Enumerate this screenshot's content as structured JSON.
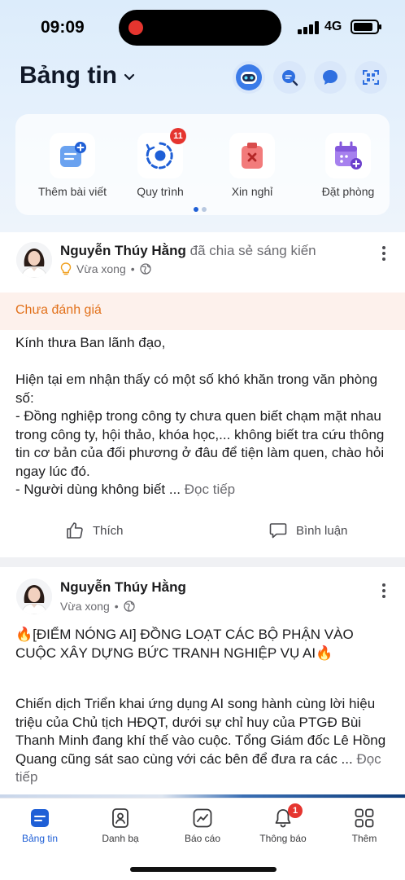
{
  "status_bar": {
    "time": "09:09",
    "network": "4G"
  },
  "header": {
    "title": "Bảng tin",
    "buttons": [
      {
        "icon": "ai-bot-icon"
      },
      {
        "icon": "search-chat-icon"
      },
      {
        "icon": "chat-bubble-icon"
      },
      {
        "icon": "scan-qr-icon"
      }
    ]
  },
  "quick_actions": {
    "items": [
      {
        "label": "Thêm bài viết",
        "icon": "add-post-icon"
      },
      {
        "label": "Quy trình",
        "icon": "workflow-icon",
        "badge": "11"
      },
      {
        "label": "Xin nghỉ",
        "icon": "leave-request-icon"
      },
      {
        "label": "Đặt phòng",
        "icon": "book-room-icon"
      }
    ],
    "page_count": 2,
    "current_page": 1
  },
  "posts": [
    {
      "author": "Nguyễn Thúy Hằng",
      "action": "đã chia sẻ sáng kiến",
      "time": "Vừa xong",
      "status": "Chưa đánh giá",
      "paragraphs": [
        "Kính thưa Ban lãnh đạo,",
        "Hiện tại em nhận thấy có một số khó khăn trong văn phòng số:",
        "- Đồng nghiệp trong công ty chưa quen biết chạm mặt nhau trong công ty, hội thảo, khóa học,... không biết tra cứu thông tin cơ bản của đối phương ở đâu để tiện làm quen, chào hỏi ngay lúc đó.",
        "- Người dùng không biết ..."
      ],
      "read_more": "Đọc tiếp",
      "like_label": "Thích",
      "comment_label": "Bình luận"
    },
    {
      "author": "Nguyễn Thúy Hằng",
      "time": "Vừa xong",
      "headline": "🔥[ĐIỂM NÓNG AI] ĐỒNG LOẠT CÁC BỘ PHẬN VÀO CUỘC XÂY DỰNG BỨC TRANH NGHIỆP VỤ AI🔥",
      "body": "Chiến dịch Triển khai ứng dụng AI song hành cùng lời hiệu triệu của Chủ tịch HĐQT, dưới sự chỉ huy của PTGĐ Bùi Thanh Minh đang khí thế vào cuộc. Tổng Giám đốc Lê Hồng Quang cũng sát sao cùng với các bên để đưa ra các ...",
      "read_more": "Đọc tiếp"
    }
  ],
  "bottom_nav": [
    {
      "label": "Bảng tin",
      "icon": "newsfeed-icon",
      "active": true
    },
    {
      "label": "Danh bạ",
      "icon": "contacts-icon"
    },
    {
      "label": "Báo cáo",
      "icon": "report-chart-icon"
    },
    {
      "label": "Thông báo",
      "icon": "bell-icon",
      "badge": "1"
    },
    {
      "label": "Thêm",
      "icon": "grid-more-icon"
    }
  ],
  "colors": {
    "accent": "#1f5fd6",
    "badge": "#e5352f",
    "status_pending": "#e2711b"
  }
}
